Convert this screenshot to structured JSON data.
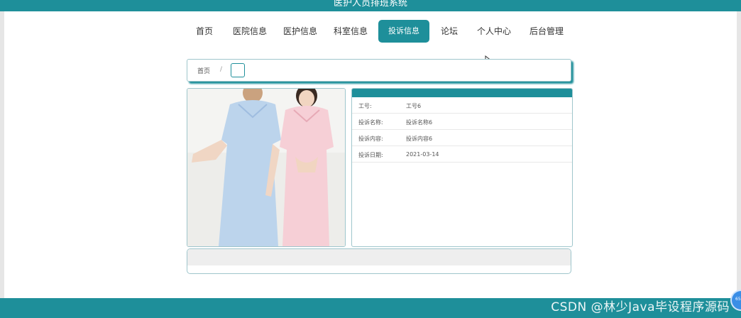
{
  "app": {
    "title": "医护人员排班系统"
  },
  "nav": {
    "items": [
      {
        "label": "首页"
      },
      {
        "label": "医院信息"
      },
      {
        "label": "医护信息"
      },
      {
        "label": "科室信息"
      },
      {
        "label": "投诉信息"
      },
      {
        "label": "论坛"
      },
      {
        "label": "个人中心"
      },
      {
        "label": "后台管理"
      }
    ],
    "active": "投诉信息"
  },
  "breadcrumb": {
    "home": "首页",
    "separator": "/"
  },
  "detail": {
    "rows": [
      {
        "label": "工号:",
        "value": "工号6"
      },
      {
        "label": "投诉名称:",
        "value": "投诉名称6"
      },
      {
        "label": "投诉内容:",
        "value": "投诉内容6"
      },
      {
        "label": "投诉日期:",
        "value": "2021-03-14"
      }
    ]
  },
  "watermark": "CSDN @林少Java毕设程序源码",
  "theme": {
    "primary": "#1e8f9a",
    "border": "#9fc6cc"
  },
  "icons": {
    "cursor": "mouse-pointer-icon",
    "badge": "floating-assistant-icon"
  }
}
